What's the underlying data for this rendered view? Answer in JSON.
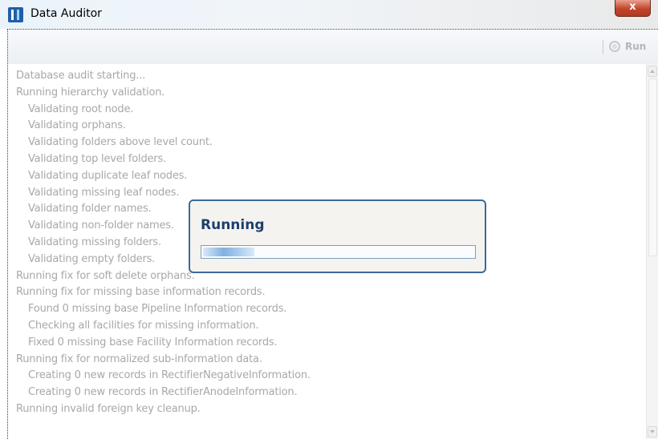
{
  "window": {
    "title": "Data Auditor",
    "close_label": "x"
  },
  "toolbar": {
    "run_label": "Run"
  },
  "log": [
    {
      "text": "Database audit starting...",
      "indent": false
    },
    {
      "text": "Running hierarchy validation.",
      "indent": false
    },
    {
      "text": "Validating root node.",
      "indent": true
    },
    {
      "text": "Validating orphans.",
      "indent": true
    },
    {
      "text": "Validating folders above level count.",
      "indent": true
    },
    {
      "text": "Validating top level folders.",
      "indent": true
    },
    {
      "text": "Validating duplicate leaf nodes.",
      "indent": true
    },
    {
      "text": "Validating missing leaf nodes.",
      "indent": true
    },
    {
      "text": "Validating folder names.",
      "indent": true
    },
    {
      "text": "Validating non-folder names.",
      "indent": true
    },
    {
      "text": "Validating missing folders.",
      "indent": true
    },
    {
      "text": "Validating empty folders.",
      "indent": true
    },
    {
      "text": "Running fix for soft delete orphans.",
      "indent": false
    },
    {
      "text": "Running fix for missing base information records.",
      "indent": false
    },
    {
      "text": "Found 0 missing base Pipeline Information records.",
      "indent": true
    },
    {
      "text": "Checking all facilities for missing information.",
      "indent": true
    },
    {
      "text": "Fixed 0 missing base Facility Information records.",
      "indent": true
    },
    {
      "text": "Running fix for normalized sub-information data.",
      "indent": false
    },
    {
      "text": "Creating 0 new records in RectifierNegativeInformation.",
      "indent": true
    },
    {
      "text": "Creating 0 new records in RectifierAnodeInformation.",
      "indent": true
    },
    {
      "text": "Running invalid foreign key cleanup.",
      "indent": false
    }
  ],
  "dialog": {
    "title": "Running",
    "progress": 0.19
  },
  "colors": {
    "log_text": "#a8a8a8",
    "dialog_title": "#1e3f6e",
    "dialog_border": "#3c6a9a"
  }
}
